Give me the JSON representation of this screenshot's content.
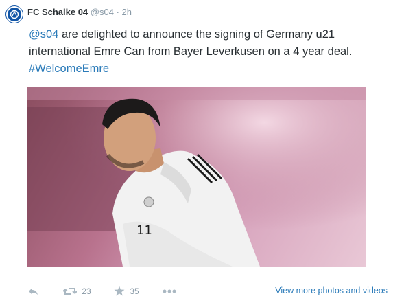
{
  "tweet": {
    "display_name": "FC Schalke 04",
    "handle": "@s04",
    "separator": "·",
    "time": "2h",
    "mention": "@s04",
    "text_line1": "are delighted to announce the signing of Germany u21",
    "text_line2": "international Emre Can from Bayer Leverkusen on a 4 year deal.",
    "hashtag": "#WelcomeEmre"
  },
  "actions": {
    "retweet_count": "23",
    "favorite_count": "35",
    "view_more": "View more photos and videos"
  },
  "icons": [
    "schalke-logo-icon",
    "reply-icon",
    "retweet-icon",
    "star-icon",
    "more-icon"
  ],
  "colors": {
    "link": "#2b7bb9",
    "muted": "#8899a6",
    "brand": "#1155a6"
  }
}
